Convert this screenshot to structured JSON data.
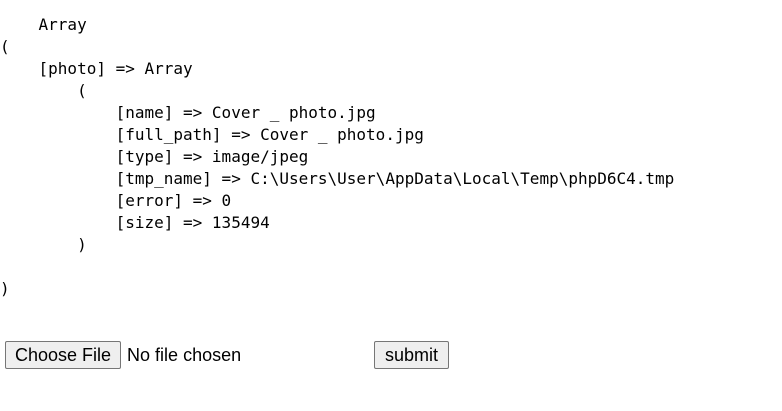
{
  "dump": {
    "lines": [
      "    Array",
      "(",
      "    [photo] => Array",
      "        (",
      "            [name] => Cover _ photo.jpg",
      "            [full_path] => Cover _ photo.jpg",
      "            [type] => image/jpeg",
      "            [tmp_name] => C:\\Users\\User\\AppData\\Local\\Temp\\phpD6C4.tmp",
      "            [error] => 0",
      "            [size] => 135494",
      "        )",
      "",
      ")"
    ]
  },
  "form": {
    "choose_file_label": "Choose File",
    "file_status": "No file chosen",
    "submit_label": "submit"
  },
  "colors": {
    "background": "#ffffff",
    "text": "#000000",
    "button_bg": "#efefef",
    "button_border": "#767676"
  }
}
